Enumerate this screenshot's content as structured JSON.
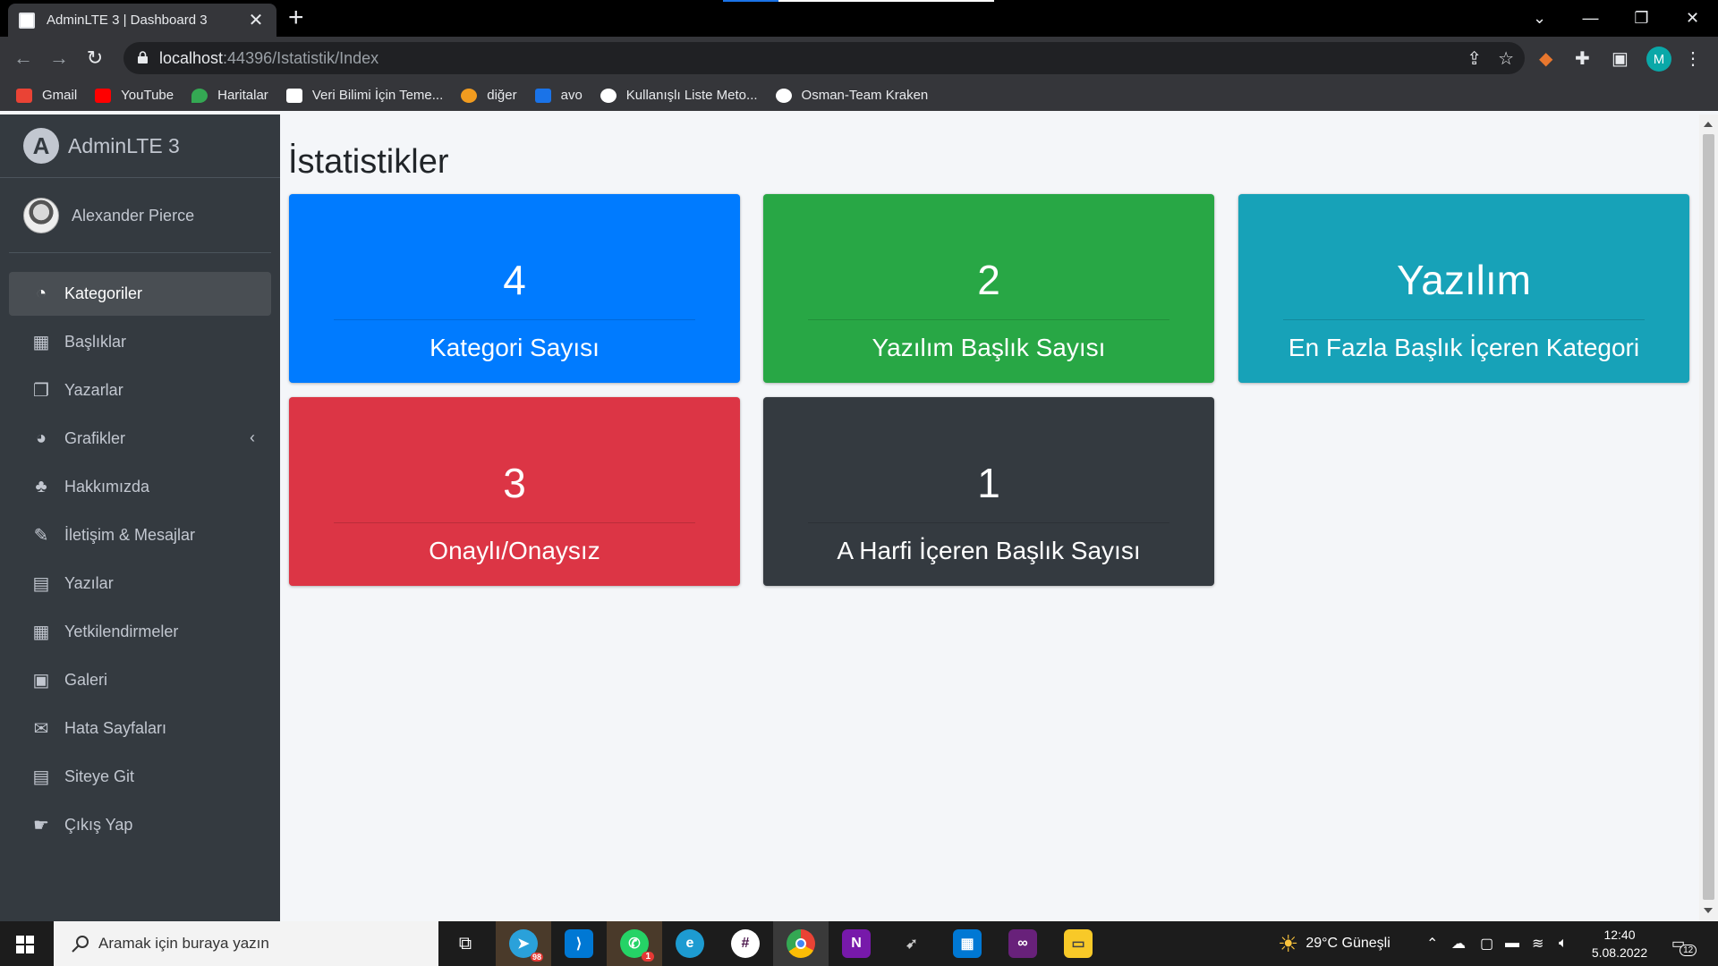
{
  "browser": {
    "tab_title": "AdminLTE 3 | Dashboard 3",
    "url_host": "localhost",
    "url_path": ":44396/Istatistik/Index",
    "profile_initial": "M",
    "bookmarks": [
      {
        "label": "Gmail",
        "icon": "gmail-icon",
        "color": "#ea4335"
      },
      {
        "label": "YouTube",
        "icon": "youtube-icon",
        "color": "#ff0000"
      },
      {
        "label": "Haritalar",
        "icon": "maps-icon",
        "color": "#34a853"
      },
      {
        "label": "Veri Bilimi İçin Teme...",
        "icon": "media-icon",
        "color": "#ffffff"
      },
      {
        "label": "diğer",
        "icon": "folder-icon",
        "color": "#f29c1f"
      },
      {
        "label": "avo",
        "icon": "avo-icon",
        "color": "#1a73e8"
      },
      {
        "label": "Kullanışlı Liste Meto...",
        "icon": "globe-icon",
        "color": "#ffffff"
      },
      {
        "label": "Osman-Team Kraken",
        "icon": "globe-icon",
        "color": "#ffffff"
      }
    ]
  },
  "sidebar": {
    "brand": "AdminLTE 3",
    "brand_letter": "A",
    "user_name": "Alexander Pierce",
    "items": [
      {
        "label": "Kategoriler",
        "icon": "dashboard-icon",
        "glyph": "◔",
        "active": true
      },
      {
        "label": "Başlıklar",
        "icon": "grid-icon",
        "glyph": "▦"
      },
      {
        "label": "Yazarlar",
        "icon": "copy-icon",
        "glyph": "❐"
      },
      {
        "label": "Grafikler",
        "icon": "pie-chart-icon",
        "glyph": "◕",
        "has_children": true
      },
      {
        "label": "Hakkımızda",
        "icon": "tree-icon",
        "glyph": "♣"
      },
      {
        "label": "İletişim & Mesajlar",
        "icon": "edit-icon",
        "glyph": "✎"
      },
      {
        "label": "Yazılar",
        "icon": "table-icon",
        "glyph": "▤"
      },
      {
        "label": "Yetkilendirmeler",
        "icon": "calendar-icon",
        "glyph": "▦"
      },
      {
        "label": "Galeri",
        "icon": "image-icon",
        "glyph": "▣"
      },
      {
        "label": "Hata Sayfaları",
        "icon": "envelope-icon",
        "glyph": "✉"
      },
      {
        "label": "Siteye Git",
        "icon": "book-icon",
        "glyph": "▤"
      },
      {
        "label": "Çıkış Yap",
        "icon": "hand-pointing-icon",
        "glyph": "☛"
      }
    ]
  },
  "main": {
    "title": "İstatistikler",
    "boxes": [
      {
        "value": "4",
        "label": "Kategori Sayısı",
        "color": "#007bff"
      },
      {
        "value": "2",
        "label": "Yazılım Başlık Sayısı",
        "color": "#28a745"
      },
      {
        "value": "Yazılım",
        "label": "En Fazla Başlık İçeren Kategori",
        "color": "#17a2b8"
      },
      {
        "value": "3",
        "label": "Onaylı/Onaysız",
        "color": "#dc3545"
      },
      {
        "value": "1",
        "label": "A Harfi İçeren Başlık Sayısı",
        "color": "#343a40"
      }
    ]
  },
  "taskbar": {
    "search_placeholder": "Aramak için buraya yazın",
    "weather": "29°C  Güneşli",
    "time": "12:40",
    "date": "5.08.2022",
    "telegram_badge": "98",
    "whatsapp_badge": "1",
    "notification_count": "12"
  }
}
